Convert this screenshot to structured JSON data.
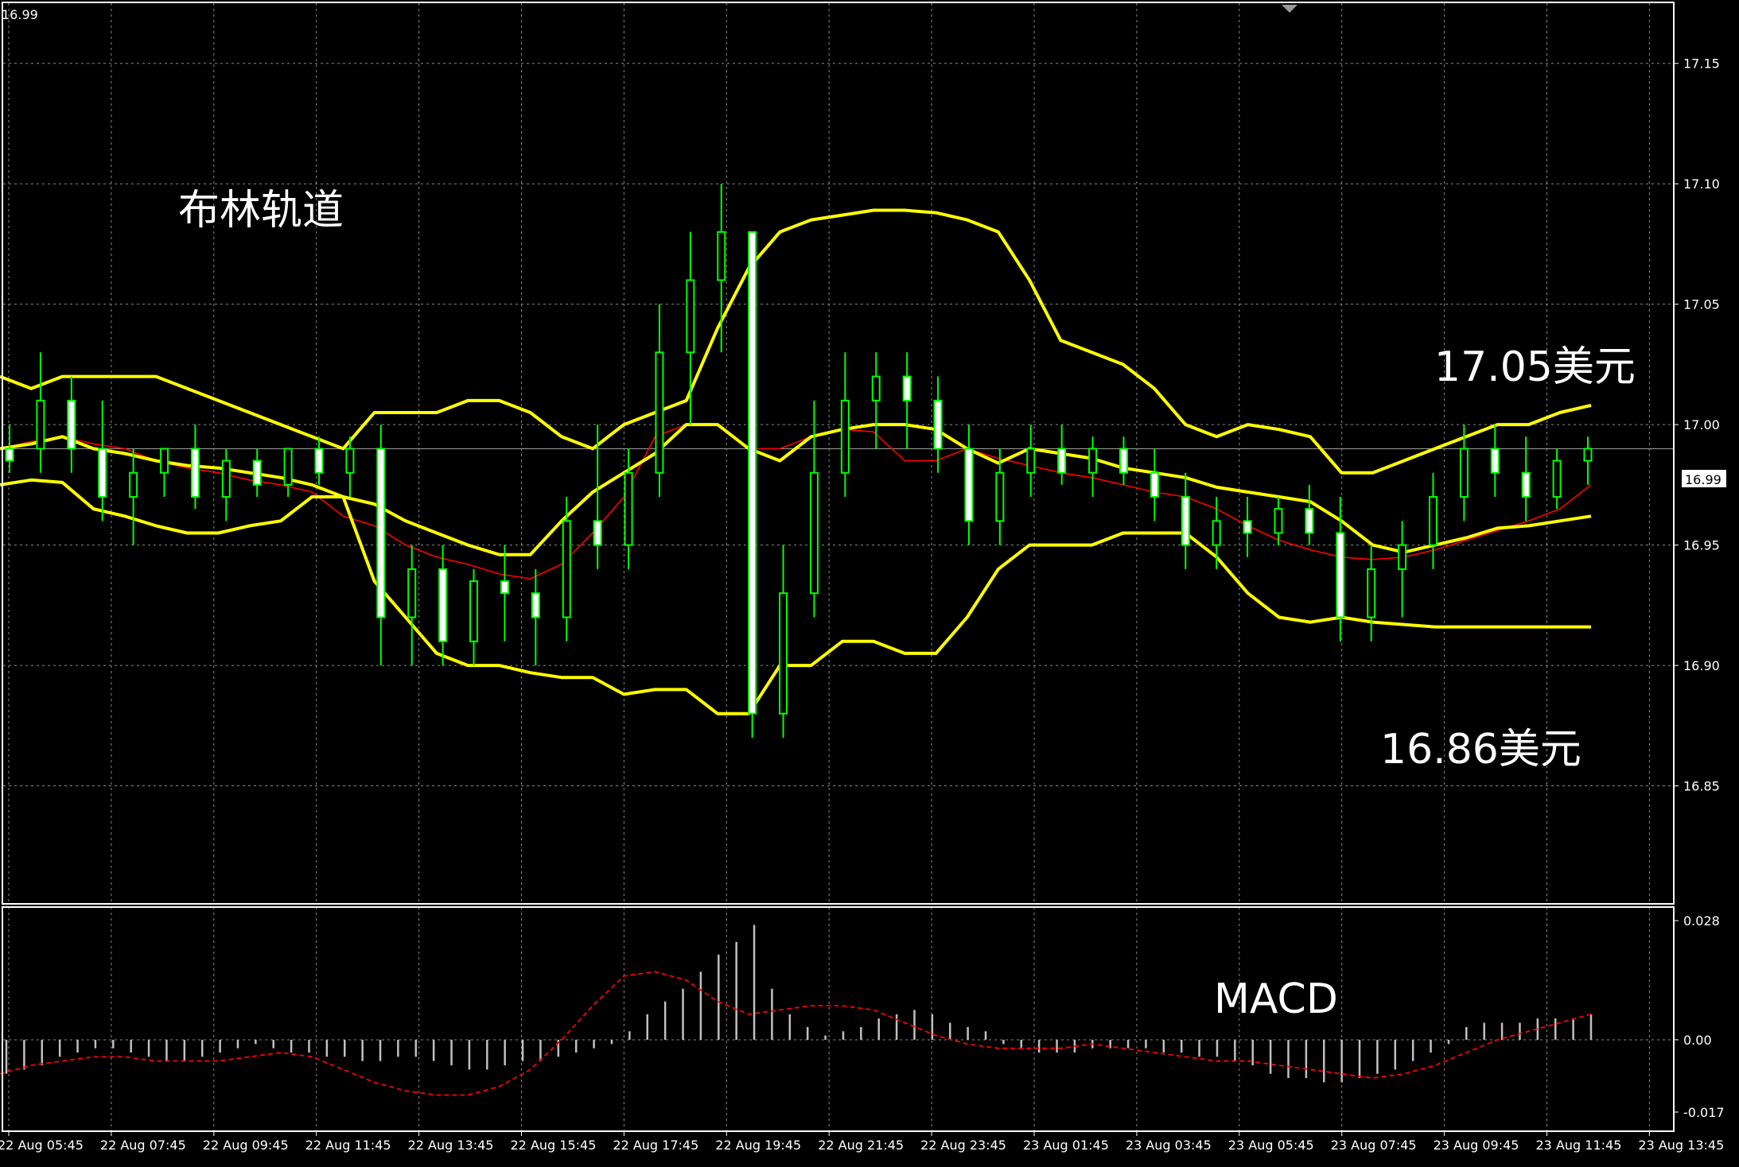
{
  "header": {
    "corner_price": "16.99"
  },
  "annotations": {
    "bollinger_title": "布林轨道",
    "upper_target": "17.05美元",
    "lower_target": "16.86美元",
    "macd_title": "MACD"
  },
  "chart_data": [
    {
      "type": "candlestick",
      "indicator": "Bollinger Bands",
      "y_ticks": [
        "17.15",
        "17.10",
        "17.05",
        "17.00",
        "16.95",
        "16.90",
        "16.85"
      ],
      "ylim": [
        16.801,
        17.175
      ],
      "current_price": "16.99",
      "current_price_value": 16.99,
      "x_ticks": [
        "22 Aug 05:45",
        "22 Aug 07:45",
        "22 Aug 09:45",
        "22 Aug 11:45",
        "22 Aug 13:45",
        "22 Aug 15:45",
        "22 Aug 17:45",
        "22 Aug 19:45",
        "22 Aug 21:45",
        "22 Aug 23:45",
        "23 Aug 01:45",
        "23 Aug 03:45",
        "23 Aug 05:45",
        "23 Aug 07:45",
        "23 Aug 09:45",
        "23 Aug 11:45",
        "23 Aug 13:45"
      ],
      "grid": true,
      "colors": {
        "background": "#000000",
        "grid": "#8a8a8a",
        "candle_up": "#00ff00",
        "candle_down": "#ffffff",
        "bands": "#ffff00",
        "middle_ma": "#ff0000",
        "price_line": "#a0a0a0"
      },
      "upper_band": [
        17.02,
        17.015,
        17.02,
        17.02,
        17.02,
        17.02,
        17.015,
        17.01,
        17.005,
        17.0,
        16.995,
        16.99,
        17.005,
        17.005,
        17.005,
        17.01,
        17.01,
        17.005,
        16.995,
        16.99,
        17.0,
        17.005,
        17.01,
        17.04,
        17.065,
        17.08,
        17.085,
        17.087,
        17.089,
        17.089,
        17.088,
        17.085,
        17.08,
        17.06,
        17.035,
        17.03,
        17.025,
        17.015,
        17.0,
        16.995,
        17.0,
        16.998,
        16.995,
        16.98,
        16.98,
        16.985,
        16.99,
        16.995,
        17.0,
        17.0,
        17.005,
        17.008
      ],
      "middle_band": [
        16.99,
        16.992,
        16.995,
        16.99,
        16.988,
        16.985,
        16.983,
        16.982,
        16.98,
        16.978,
        16.975,
        16.97,
        16.967,
        16.96,
        16.955,
        16.95,
        16.946,
        16.946,
        16.96,
        16.972,
        16.98,
        16.988,
        17.0,
        17.0,
        16.99,
        16.985,
        16.995,
        16.998,
        17.0,
        17.0,
        16.998,
        16.99,
        16.984,
        16.99,
        16.988,
        16.986,
        16.982,
        16.98,
        16.978,
        16.974,
        16.972,
        16.97,
        16.968,
        16.96,
        16.95,
        16.947,
        16.95,
        16.953,
        16.957,
        16.958,
        16.96,
        16.962
      ],
      "lower_band": [
        16.975,
        16.977,
        16.976,
        16.965,
        16.962,
        16.958,
        16.955,
        16.955,
        16.958,
        16.96,
        16.97,
        16.97,
        16.935,
        16.92,
        16.905,
        16.9,
        16.9,
        16.897,
        16.895,
        16.895,
        16.888,
        16.89,
        16.89,
        16.88,
        16.88,
        16.9,
        16.9,
        16.91,
        16.91,
        16.905,
        16.905,
        16.92,
        16.94,
        16.95,
        16.95,
        16.95,
        16.955,
        16.955,
        16.955,
        16.945,
        16.93,
        16.92,
        16.918,
        16.92,
        16.918,
        16.917,
        16.916,
        16.916,
        16.916,
        16.916,
        16.916,
        16.916
      ],
      "middle_ma": [
        16.99,
        16.993,
        16.995,
        16.992,
        16.99,
        16.985,
        16.982,
        16.98,
        16.977,
        16.975,
        16.972,
        16.962,
        16.958,
        16.95,
        16.945,
        16.942,
        16.938,
        16.936,
        16.942,
        16.955,
        16.97,
        16.995,
        17.0,
        17.0,
        16.99,
        16.99,
        16.995,
        16.998,
        16.997,
        16.985,
        16.985,
        16.99,
        16.986,
        16.983,
        16.98,
        16.978,
        16.975,
        16.972,
        16.97,
        16.965,
        16.958,
        16.952,
        16.948,
        16.945,
        16.944,
        16.945,
        16.948,
        16.952,
        16.956,
        16.96,
        16.965,
        16.975
      ],
      "candles": [
        {
          "o": 16.99,
          "h": 17.0,
          "l": 16.98,
          "c": 16.985
        },
        {
          "o": 16.99,
          "h": 17.03,
          "l": 16.98,
          "c": 17.01
        },
        {
          "o": 17.01,
          "h": 17.02,
          "l": 16.98,
          "c": 16.99
        },
        {
          "o": 16.99,
          "h": 17.01,
          "l": 16.96,
          "c": 16.97
        },
        {
          "o": 16.97,
          "h": 16.99,
          "l": 16.95,
          "c": 16.98
        },
        {
          "o": 16.98,
          "h": 16.99,
          "l": 16.97,
          "c": 16.99
        },
        {
          "o": 16.99,
          "h": 17.0,
          "l": 16.965,
          "c": 16.97
        },
        {
          "o": 16.97,
          "h": 16.99,
          "l": 16.96,
          "c": 16.985
        },
        {
          "o": 16.985,
          "h": 16.99,
          "l": 16.97,
          "c": 16.975
        },
        {
          "o": 16.975,
          "h": 16.99,
          "l": 16.97,
          "c": 16.99
        },
        {
          "o": 16.99,
          "h": 16.995,
          "l": 16.975,
          "c": 16.98
        },
        {
          "o": 16.98,
          "h": 16.995,
          "l": 16.97,
          "c": 16.99
        },
        {
          "o": 16.99,
          "h": 17.0,
          "l": 16.9,
          "c": 16.92
        },
        {
          "o": 16.92,
          "h": 16.95,
          "l": 16.9,
          "c": 16.94
        },
        {
          "o": 16.94,
          "h": 16.95,
          "l": 16.9,
          "c": 16.91
        },
        {
          "o": 16.91,
          "h": 16.94,
          "l": 16.9,
          "c": 16.935
        },
        {
          "o": 16.935,
          "h": 16.95,
          "l": 16.91,
          "c": 16.93
        },
        {
          "o": 16.93,
          "h": 16.94,
          "l": 16.9,
          "c": 16.92
        },
        {
          "o": 16.92,
          "h": 16.97,
          "l": 16.91,
          "c": 16.96
        },
        {
          "o": 16.96,
          "h": 17.0,
          "l": 16.94,
          "c": 16.95
        },
        {
          "o": 16.95,
          "h": 16.99,
          "l": 16.94,
          "c": 16.98
        },
        {
          "o": 16.98,
          "h": 17.05,
          "l": 16.97,
          "c": 17.03
        },
        {
          "o": 17.03,
          "h": 17.08,
          "l": 17.0,
          "c": 17.06
        },
        {
          "o": 17.06,
          "h": 17.1,
          "l": 17.03,
          "c": 17.08
        },
        {
          "o": 17.08,
          "h": 17.08,
          "l": 16.87,
          "c": 16.88
        },
        {
          "o": 16.88,
          "h": 16.95,
          "l": 16.87,
          "c": 16.93
        },
        {
          "o": 16.93,
          "h": 17.01,
          "l": 16.92,
          "c": 16.98
        },
        {
          "o": 16.98,
          "h": 17.03,
          "l": 16.97,
          "c": 17.01
        },
        {
          "o": 17.01,
          "h": 17.03,
          "l": 16.99,
          "c": 17.02
        },
        {
          "o": 17.02,
          "h": 17.03,
          "l": 16.99,
          "c": 17.01
        },
        {
          "o": 17.01,
          "h": 17.02,
          "l": 16.98,
          "c": 16.99
        },
        {
          "o": 16.99,
          "h": 17.0,
          "l": 16.95,
          "c": 16.96
        },
        {
          "o": 16.96,
          "h": 16.99,
          "l": 16.95,
          "c": 16.98
        },
        {
          "o": 16.98,
          "h": 17.0,
          "l": 16.97,
          "c": 16.99
        },
        {
          "o": 16.99,
          "h": 17.0,
          "l": 16.975,
          "c": 16.98
        },
        {
          "o": 16.98,
          "h": 16.995,
          "l": 16.97,
          "c": 16.99
        },
        {
          "o": 16.99,
          "h": 16.995,
          "l": 16.975,
          "c": 16.98
        },
        {
          "o": 16.98,
          "h": 16.99,
          "l": 16.96,
          "c": 16.97
        },
        {
          "o": 16.97,
          "h": 16.98,
          "l": 16.94,
          "c": 16.95
        },
        {
          "o": 16.95,
          "h": 16.97,
          "l": 16.94,
          "c": 16.96
        },
        {
          "o": 16.96,
          "h": 16.97,
          "l": 16.945,
          "c": 16.955
        },
        {
          "o": 16.955,
          "h": 16.97,
          "l": 16.95,
          "c": 16.965
        },
        {
          "o": 16.965,
          "h": 16.975,
          "l": 16.95,
          "c": 16.955
        },
        {
          "o": 16.955,
          "h": 16.97,
          "l": 16.91,
          "c": 16.92
        },
        {
          "o": 16.92,
          "h": 16.95,
          "l": 16.91,
          "c": 16.94
        },
        {
          "o": 16.94,
          "h": 16.96,
          "l": 16.92,
          "c": 16.95
        },
        {
          "o": 16.95,
          "h": 16.98,
          "l": 16.94,
          "c": 16.97
        },
        {
          "o": 16.97,
          "h": 17.0,
          "l": 16.96,
          "c": 16.99
        },
        {
          "o": 16.99,
          "h": 17.0,
          "l": 16.97,
          "c": 16.98
        },
        {
          "o": 16.98,
          "h": 16.995,
          "l": 16.96,
          "c": 16.97
        },
        {
          "o": 16.97,
          "h": 16.99,
          "l": 16.965,
          "c": 16.985
        },
        {
          "o": 16.985,
          "h": 16.995,
          "l": 16.975,
          "c": 16.99
        }
      ]
    },
    {
      "type": "bar",
      "indicator": "MACD",
      "y_ticks": [
        "0.028",
        "0.00",
        "-0.017"
      ],
      "ylim": [
        -0.0215,
        0.0312
      ],
      "colors": {
        "histogram": "#c0c0c0",
        "signal": "#ff0000"
      },
      "histogram": [
        -0.008,
        -0.007,
        -0.006,
        -0.004,
        -0.003,
        -0.002,
        -0.002,
        -0.003,
        -0.004,
        -0.005,
        -0.005,
        -0.004,
        -0.003,
        -0.002,
        -0.001,
        -0.002,
        -0.003,
        -0.003,
        -0.004,
        -0.004,
        -0.005,
        -0.005,
        -0.004,
        -0.004,
        -0.005,
        -0.006,
        -0.007,
        -0.007,
        -0.006,
        -0.005,
        -0.005,
        -0.004,
        -0.003,
        -0.002,
        -0.001,
        0.002,
        0.006,
        0.009,
        0.012,
        0.016,
        0.02,
        0.023,
        0.027,
        0.012,
        0.006,
        0.003,
        0.001,
        0.002,
        0.003,
        0.005,
        0.006,
        0.007,
        0.006,
        0.004,
        0.003,
        0.002,
        -0.001,
        -0.002,
        -0.003,
        -0.003,
        -0.003,
        -0.002,
        -0.002,
        -0.002,
        -0.002,
        -0.003,
        -0.003,
        -0.004,
        -0.004,
        -0.005,
        -0.006,
        -0.008,
        -0.009,
        -0.009,
        -0.01,
        -0.01,
        -0.009,
        -0.008,
        -0.007,
        -0.005,
        -0.003,
        -0.001,
        0.003,
        0.004,
        0.004,
        0.004,
        0.005,
        0.005,
        0.005,
        0.006
      ],
      "signal": [
        -0.008,
        -0.006,
        -0.005,
        -0.004,
        -0.004,
        -0.005,
        -0.005,
        -0.005,
        -0.004,
        -0.003,
        -0.004,
        -0.007,
        -0.01,
        -0.012,
        -0.013,
        -0.013,
        -0.011,
        -0.007,
        0.0,
        0.008,
        0.015,
        0.016,
        0.014,
        0.009,
        0.006,
        0.007,
        0.008,
        0.008,
        0.007,
        0.004,
        0.001,
        -0.001,
        -0.002,
        -0.002,
        -0.002,
        -0.001,
        -0.002,
        -0.003,
        -0.004,
        -0.005,
        -0.005,
        -0.006,
        -0.007,
        -0.008,
        -0.009,
        -0.008,
        -0.006,
        -0.003,
        0.0,
        0.002,
        0.004,
        0.006
      ]
    }
  ]
}
